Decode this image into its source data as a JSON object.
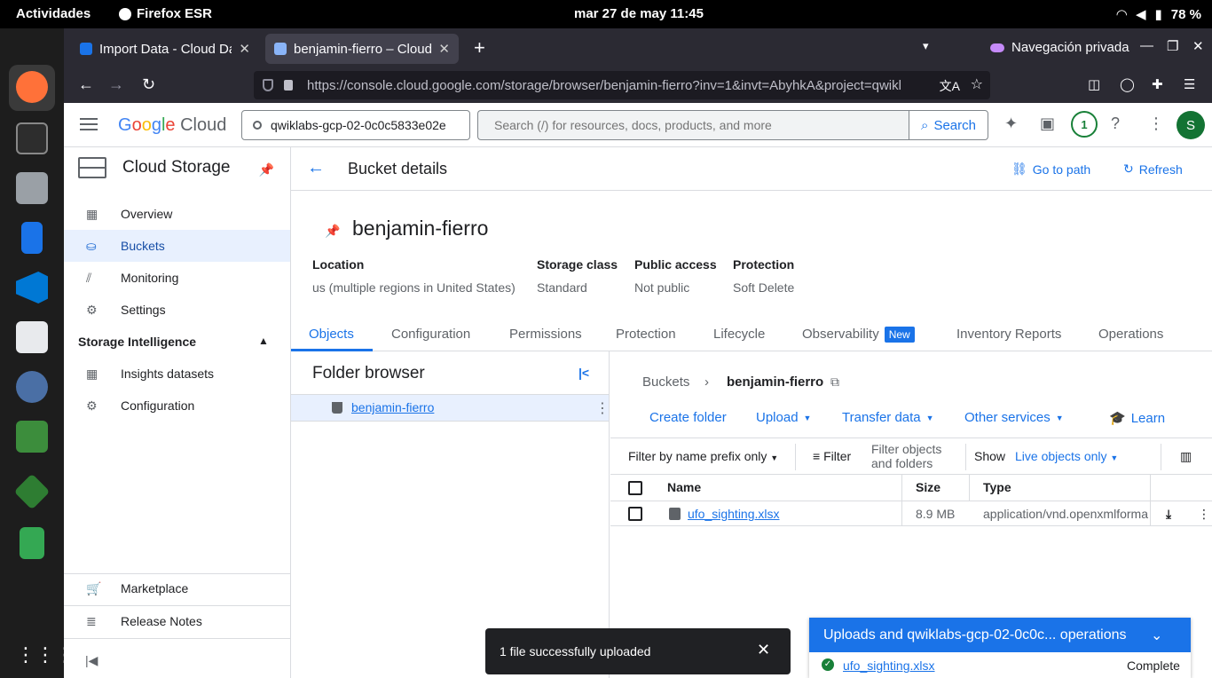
{
  "os_bar": {
    "activities": "Actividades",
    "app_name": "Firefox ESR",
    "clock": "mar 27 de may  11:45",
    "battery": "78 %"
  },
  "browser": {
    "tabs": [
      {
        "label": "Import Data - Cloud Data"
      },
      {
        "label": "benjamin-fierro – Cloud S"
      }
    ],
    "private_label": "Navegación privada",
    "url": "https://console.cloud.google.com/storage/browser/benjamin-fierro?inv=1&invt=AbyhkA&project=qwikl"
  },
  "gcp_header": {
    "logo_google": [
      "G",
      "o",
      "o",
      "g",
      "l",
      "e"
    ],
    "logo_cloud": "Cloud",
    "project": "qwiklabs-gcp-02-0c0c5833e02e",
    "search_placeholder": "Search (/) for resources, docs, products, and more",
    "search_button": "Search",
    "notif_count": "1",
    "avatar_initial": "S"
  },
  "left_nav": {
    "title": "Cloud Storage",
    "items": [
      {
        "label": "Overview"
      },
      {
        "label": "Buckets"
      },
      {
        "label": "Monitoring"
      },
      {
        "label": "Settings"
      }
    ],
    "section": "Storage Intelligence",
    "section_items": [
      {
        "label": "Insights datasets"
      },
      {
        "label": "Configuration"
      }
    ],
    "bottom_items": [
      {
        "label": "Marketplace"
      },
      {
        "label": "Release Notes"
      }
    ]
  },
  "main": {
    "page_title": "Bucket details",
    "go_to_path": "Go to path",
    "refresh": "Refresh",
    "bucket_name": "benjamin-fierro",
    "meta": [
      {
        "key": "Location",
        "value": "us (multiple regions in United States)"
      },
      {
        "key": "Storage class",
        "value": "Standard"
      },
      {
        "key": "Public access",
        "value": "Not public"
      },
      {
        "key": "Protection",
        "value": "Soft Delete"
      }
    ],
    "tabs": [
      "Objects",
      "Configuration",
      "Permissions",
      "Protection",
      "Lifecycle",
      "Observability",
      "Inventory Reports",
      "Operations"
    ],
    "new_badge": "New"
  },
  "folder_browser": {
    "title": "Folder browser",
    "bucket": "benjamin-fierro"
  },
  "objects": {
    "breadcrumb": [
      "Buckets",
      "benjamin-fierro"
    ],
    "actions": [
      "Create folder",
      "Upload",
      "Transfer data",
      "Other services",
      "Learn"
    ],
    "filter_mode": "Filter by name prefix only",
    "filter_label": "Filter",
    "filter_placeholder": "Filter objects and folders",
    "show_label": "Show",
    "show_value": "Live objects only",
    "columns": [
      "Name",
      "Size",
      "Type"
    ],
    "rows": [
      {
        "name": "ufo_sighting.xlsx",
        "size": "8.9 MB",
        "type": "application/vnd.openxmlforma"
      }
    ]
  },
  "toast": {
    "message": "1 file successfully uploaded"
  },
  "uploads": {
    "title": "Uploads and qwiklabs-gcp-02-0c0c... operations",
    "file": "ufo_sighting.xlsx",
    "status": "Complete"
  }
}
